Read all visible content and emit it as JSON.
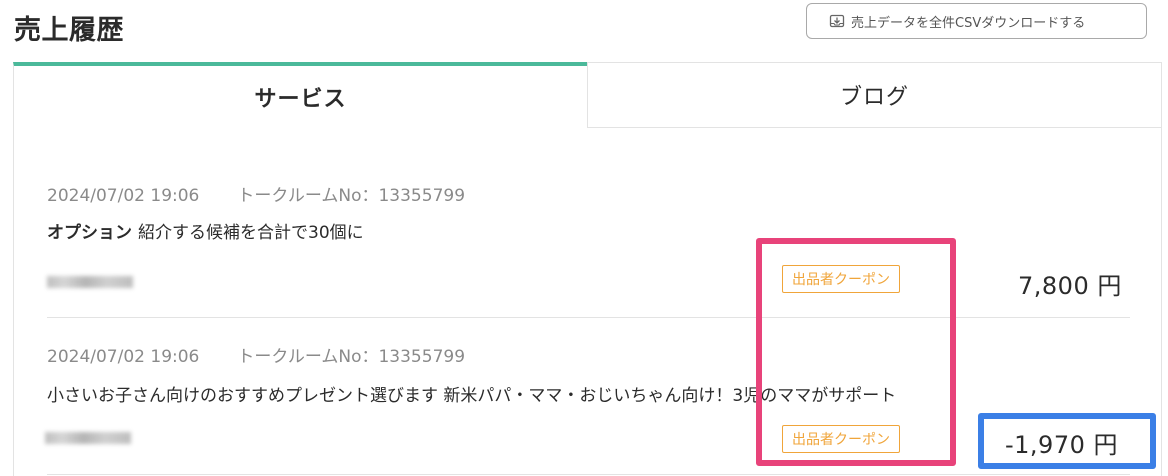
{
  "header": {
    "title": "売上履歴",
    "csv_button_label": "売上データを全件CSVダウンロードする"
  },
  "tabs": [
    {
      "label": "サービス",
      "active": true
    },
    {
      "label": "ブログ",
      "active": false
    }
  ],
  "entries": [
    {
      "datetime": "2024/07/02 19:06",
      "talkroom": "トークルームNo：13355799",
      "option_label": "オプション",
      "title": "紹介する候補を合計で30個に",
      "badge": "出品者クーポン",
      "amount": "7,800 円"
    },
    {
      "datetime": "2024/07/02 19:06",
      "talkroom": "トークルームNo：13355799",
      "title": "小さいお子さん向けのおすすめプレゼント選びます 新米パパ・ママ・おじいちゃん向け！3児のママがサポート",
      "badge": "出品者クーポン",
      "amount": "-1,970 円"
    }
  ],
  "colors": {
    "accent_green": "#4bb99a",
    "coupon_orange": "#f0a53a",
    "highlight_pink": "#e8437a",
    "highlight_blue": "#3b7fe6"
  },
  "icons": {
    "csv_button": "download-tray-icon"
  }
}
